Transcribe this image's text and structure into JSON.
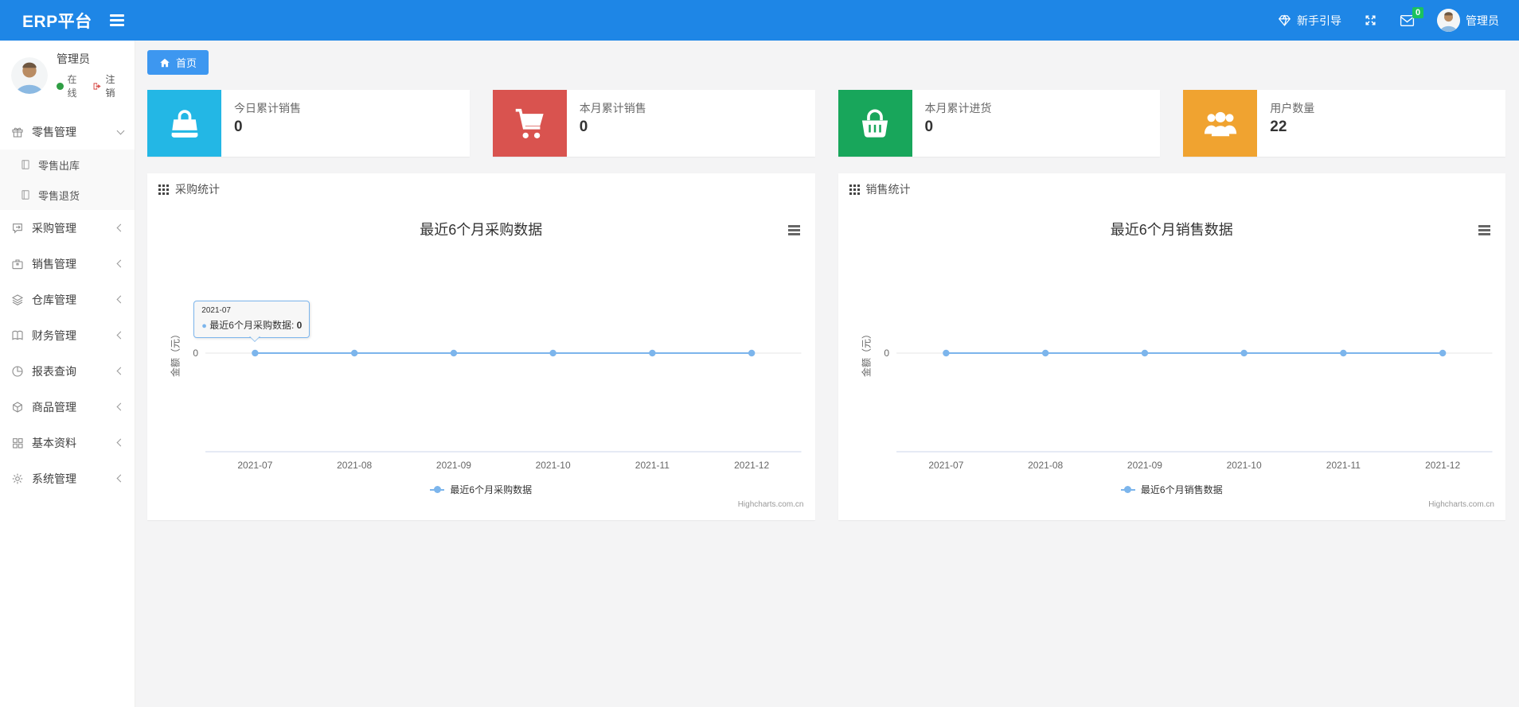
{
  "navbar": {
    "brand": "ERP平台",
    "guide_label": "新手引导",
    "badge_count": "0",
    "username": "管理员"
  },
  "sidebar": {
    "user": {
      "name": "管理员",
      "status": "在线",
      "logout": "注销"
    },
    "menu": [
      {
        "label": "零售管理",
        "icon": "gift-icon",
        "expanded": true,
        "children": [
          {
            "label": "零售出库",
            "icon": "journal-icon"
          },
          {
            "label": "零售退货",
            "icon": "journal-icon"
          }
        ]
      },
      {
        "label": "采购管理",
        "icon": "chat-icon"
      },
      {
        "label": "销售管理",
        "icon": "briefcase-icon"
      },
      {
        "label": "仓库管理",
        "icon": "layers-icon"
      },
      {
        "label": "财务管理",
        "icon": "book-icon"
      },
      {
        "label": "报表查询",
        "icon": "pie-chart-icon"
      },
      {
        "label": "商品管理",
        "icon": "package-icon"
      },
      {
        "label": "基本资料",
        "icon": "grid-icon"
      },
      {
        "label": "系统管理",
        "icon": "gear-icon"
      }
    ]
  },
  "tabs": {
    "home": "首页"
  },
  "stat_cards": [
    {
      "label": "今日累计销售",
      "value": "0",
      "icon": "bag-icon",
      "color": "#23b7e5"
    },
    {
      "label": "本月累计销售",
      "value": "0",
      "icon": "cart-icon",
      "color": "#d9534f"
    },
    {
      "label": "本月累计进货",
      "value": "0",
      "icon": "basket-icon",
      "color": "#18a65b"
    },
    {
      "label": "用户数量",
      "value": "22",
      "icon": "users-icon",
      "color": "#f0a330"
    }
  ],
  "panels": [
    {
      "header": "采购统计"
    },
    {
      "header": "销售统计"
    }
  ],
  "chart_data": [
    {
      "type": "line",
      "title": "最近6个月采购数据",
      "categories": [
        "2021-07",
        "2021-08",
        "2021-09",
        "2021-10",
        "2021-11",
        "2021-12"
      ],
      "series": [
        {
          "name": "最近6个月采购数据",
          "values": [
            0,
            0,
            0,
            0,
            0,
            0
          ],
          "color": "#7cb5ec"
        }
      ],
      "xlabel": "",
      "ylabel": "金额（元）",
      "yticks": [
        "0"
      ],
      "grid": true,
      "legend_position": "bottom",
      "credits": "Highcharts.com.cn",
      "tooltip": {
        "visible": true,
        "header": "2021-07",
        "series": "最近6个月采购数据",
        "value": "0",
        "point_index": 0
      }
    },
    {
      "type": "line",
      "title": "最近6个月销售数据",
      "categories": [
        "2021-07",
        "2021-08",
        "2021-09",
        "2021-10",
        "2021-11",
        "2021-12"
      ],
      "series": [
        {
          "name": "最近6个月销售数据",
          "values": [
            0,
            0,
            0,
            0,
            0,
            0
          ],
          "color": "#7cb5ec"
        }
      ],
      "xlabel": "",
      "ylabel": "金额（元）",
      "yticks": [
        "0"
      ],
      "grid": true,
      "legend_position": "bottom",
      "credits": "Highcharts.com.cn",
      "tooltip": {
        "visible": false
      }
    }
  ]
}
